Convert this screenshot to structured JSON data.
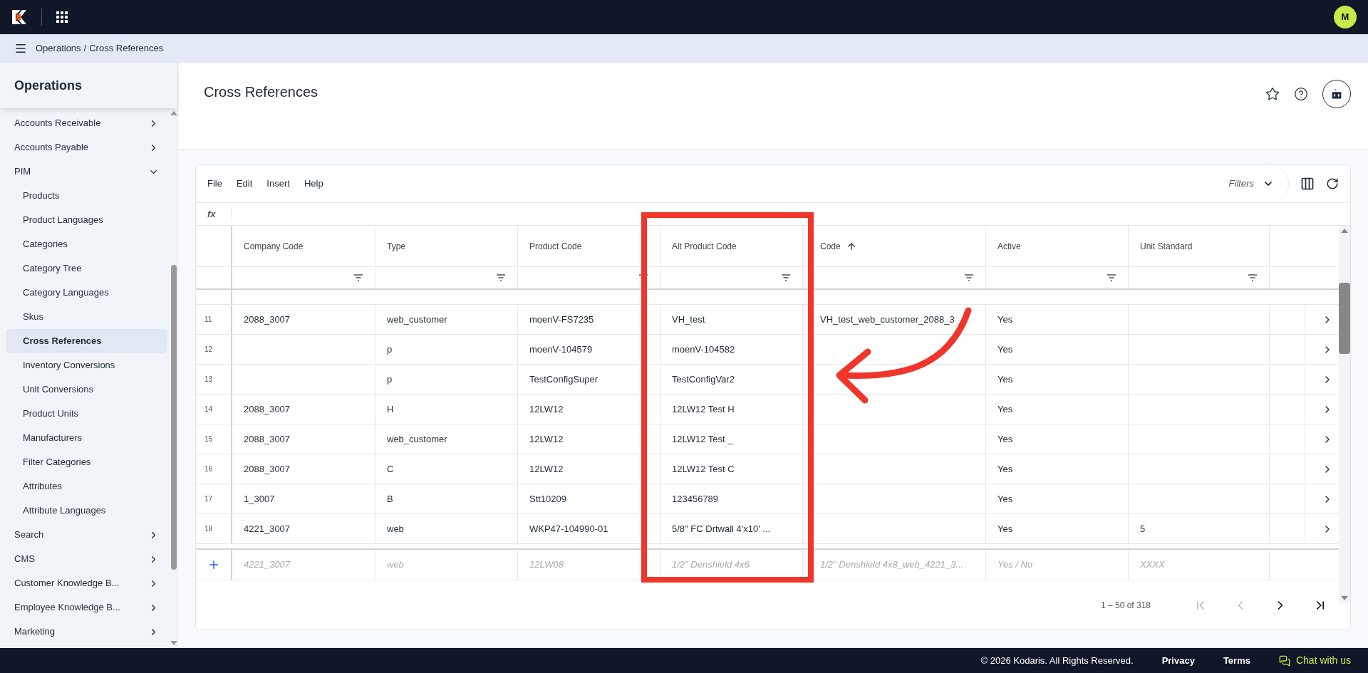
{
  "topbar": {
    "avatar": "M"
  },
  "breadcrumb": {
    "items": [
      "Operations",
      "Cross References"
    ],
    "separator": "/"
  },
  "sidebar": {
    "title": "Operations",
    "items": [
      {
        "label": "Accounts Receivable",
        "expanded": false
      },
      {
        "label": "Accounts Payable",
        "expanded": false
      },
      {
        "label": "PIM",
        "expanded": true,
        "children": [
          {
            "label": "Products",
            "selected": false
          },
          {
            "label": "Product Languages",
            "selected": false
          },
          {
            "label": "Categories",
            "selected": false
          },
          {
            "label": "Category Tree",
            "selected": false
          },
          {
            "label": "Category Languages",
            "selected": false
          },
          {
            "label": "Skus",
            "selected": false
          },
          {
            "label": "Cross References",
            "selected": true
          },
          {
            "label": "Inventory Conversions",
            "selected": false
          },
          {
            "label": "Unit Conversions",
            "selected": false
          },
          {
            "label": "Product Units",
            "selected": false
          },
          {
            "label": "Manufacturers",
            "selected": false
          },
          {
            "label": "Filter Categories",
            "selected": false
          },
          {
            "label": "Attributes",
            "selected": false
          },
          {
            "label": "Attribute Languages",
            "selected": false
          }
        ]
      },
      {
        "label": "Search",
        "expanded": false
      },
      {
        "label": "CMS",
        "expanded": false
      },
      {
        "label": "Customer Knowledge B...",
        "expanded": false
      },
      {
        "label": "Employee Knowledge B...",
        "expanded": false
      },
      {
        "label": "Marketing",
        "expanded": false
      }
    ]
  },
  "page": {
    "title": "Cross References"
  },
  "grid": {
    "menu": [
      "File",
      "Edit",
      "Insert",
      "Help"
    ],
    "filters_label": "Filters",
    "formula_label": "fx",
    "columns": [
      {
        "label": "Company Code",
        "sorted_ascending": false
      },
      {
        "label": "Type",
        "sorted_ascending": false
      },
      {
        "label": "Product Code",
        "sorted_ascending": false
      },
      {
        "label": "Alt Product Code",
        "sorted_ascending": false
      },
      {
        "label": "Code",
        "sorted_ascending": true
      },
      {
        "label": "Active",
        "sorted_ascending": false
      },
      {
        "label": "Unit Standard",
        "sorted_ascending": false
      }
    ],
    "rows": [
      {
        "number": "11",
        "cells": [
          "2088_3007",
          "web_customer",
          "moenV-FS7235",
          "VH_test",
          "VH_test_web_customer_2088_3",
          "Yes",
          ""
        ]
      },
      {
        "number": "12",
        "cells": [
          "",
          "p",
          "moenV-104579",
          "moenV-104582",
          "",
          "Yes",
          ""
        ]
      },
      {
        "number": "13",
        "cells": [
          "",
          "p",
          "TestConfigSuper",
          "TestConfigVar2",
          "",
          "Yes",
          ""
        ]
      },
      {
        "number": "14",
        "cells": [
          "2088_3007",
          "H",
          "12LW12",
          "12LW12 Test H",
          "",
          "Yes",
          ""
        ]
      },
      {
        "number": "15",
        "cells": [
          "2088_3007",
          "web_customer",
          "12LW12",
          "12LW12 Test _",
          "",
          "Yes",
          ""
        ]
      },
      {
        "number": "16",
        "cells": [
          "2088_3007",
          "C",
          "12LW12",
          "12LW12 Test C",
          "",
          "Yes",
          ""
        ]
      },
      {
        "number": "17",
        "cells": [
          "1_3007",
          "B",
          "Stt10209",
          "123456789",
          "",
          "Yes",
          ""
        ]
      },
      {
        "number": "18",
        "cells": [
          "4221_3007",
          "web",
          "WKP47-104990-01",
          "5/8\" FC Drtwall 4'x10' ...",
          "",
          "Yes",
          "5"
        ]
      }
    ],
    "new_row": {
      "placeholders": [
        "4221_3007",
        "web",
        "12LW08",
        "1/2\" Denshield 4x6",
        "1/2\" Denshield 4x8_web_4221_3...",
        "Yes / No",
        "XXXX"
      ]
    },
    "pager": {
      "range": "1 – 50 of 318",
      "can_go_back": false,
      "can_go_forward": true
    }
  },
  "footer": {
    "copyright": "© 2026 Kodaris. All Rights Reserved.",
    "links": [
      "Privacy",
      "Terms"
    ],
    "chat": "Chat with us"
  }
}
